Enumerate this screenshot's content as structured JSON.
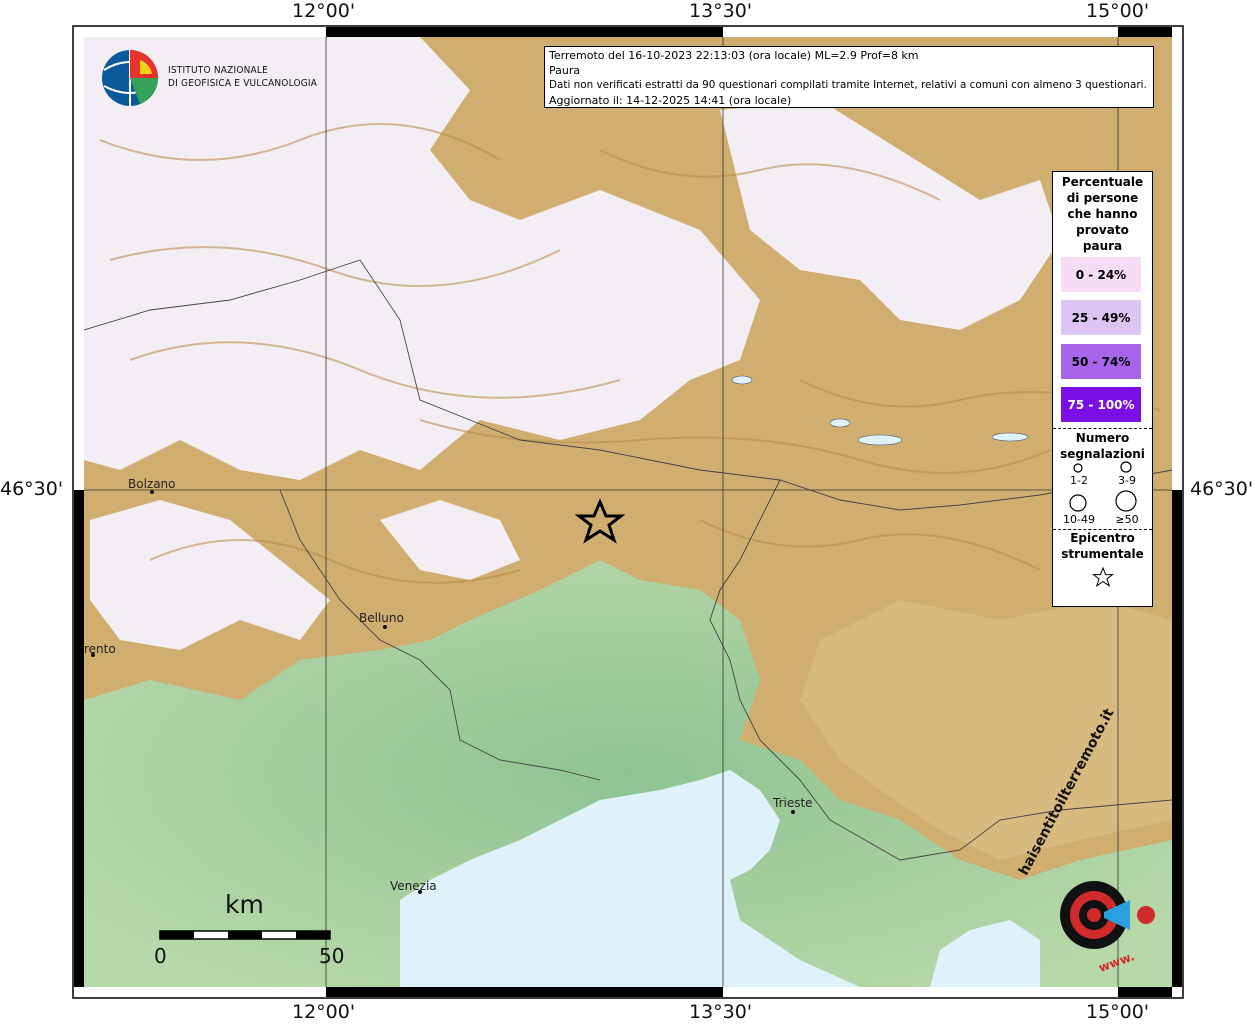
{
  "map": {
    "top_ticks": [
      "12°00'",
      "13°30'",
      "15°00'"
    ],
    "bottom_ticks": [
      "12°00'",
      "13°30'",
      "15°00'"
    ],
    "left_tick": "46°30'",
    "right_tick": "46°30'"
  },
  "logo": {
    "institute_line1": "ISTITUTO NAZIONALE",
    "institute_line2": "DI GEOFISICA E VULCANOLOGIA"
  },
  "info": {
    "line1": "Terremoto del 16-10-2023 22:13:03 (ora locale) ML=2.9 Prof=8 km",
    "line2": "Paura",
    "line3": "Dati non verificati estratti da 90 questionari compilati tramite Internet, relativi a comuni con almeno 3 questionari.",
    "line4": "Aggiornato il: 14-12-2025 14:41 (ora locale)"
  },
  "legend": {
    "title": [
      "Percentuale",
      "di persone",
      "che hanno",
      "provato",
      "paura"
    ],
    "classes": [
      {
        "label": "0 - 24%",
        "color": "#f7dcf5"
      },
      {
        "label": "25 - 49%",
        "color": "#dcc4f4"
      },
      {
        "label": "50 - 74%",
        "color": "#a864ea"
      },
      {
        "label": "75 - 100%",
        "color": "#7a10e6"
      }
    ],
    "count_title": [
      "Numero",
      "segnalazioni"
    ],
    "count_classes": [
      "1-2",
      "3-9",
      "10-49",
      "≥50"
    ],
    "epi_title": [
      "Epicentro",
      "strumentale"
    ]
  },
  "cities": [
    "Bolzano",
    "Belluno",
    "rento",
    "Trieste",
    "Venezia"
  ],
  "scale": {
    "unit": "km",
    "min": "0",
    "max": "50"
  },
  "badge": {
    "text": "haisentitoilterremoto.it",
    "url": "www."
  },
  "colors": {
    "sea": "#dff1fb",
    "plain": "#9fce9e",
    "hills": "#c9a86a",
    "mountains": "#f4f0f4"
  }
}
